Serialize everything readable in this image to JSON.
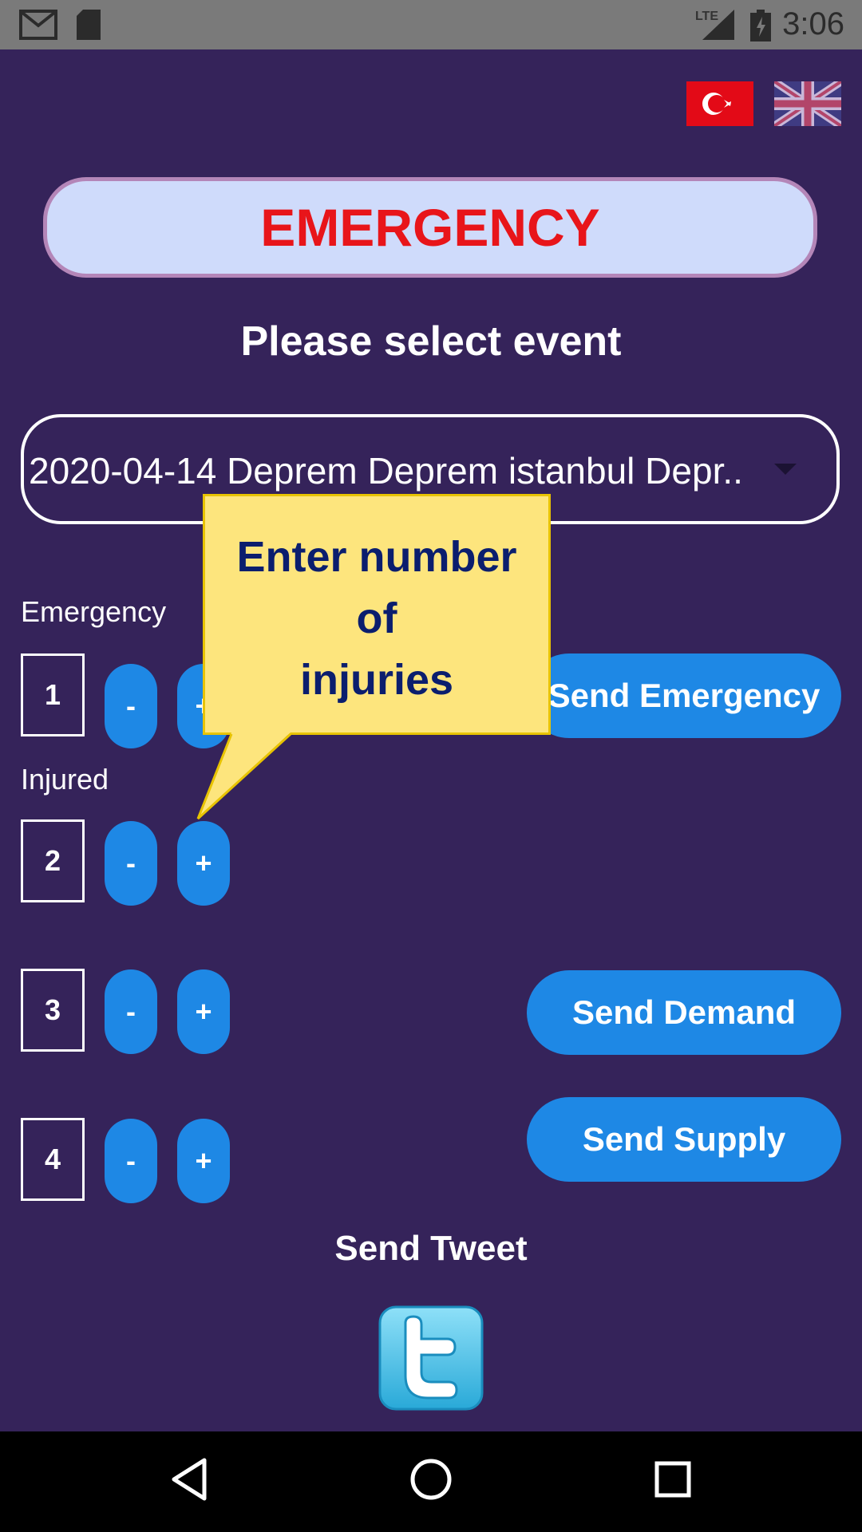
{
  "status_bar": {
    "time": "3:06",
    "network": "LTE"
  },
  "flags": {
    "turkish": "turkish-flag",
    "english": "uk-flag"
  },
  "header": {
    "title": "EMERGENCY",
    "subtitle": "Please select event"
  },
  "event_select": {
    "value": "2020-04-14 Deprem Deprem istanbul Depr.."
  },
  "tooltip": {
    "line1": "Enter number",
    "line2": "of",
    "line3": "injuries"
  },
  "counters": [
    {
      "label": "Emergency",
      "value": "1",
      "minus": "-",
      "plus": "+"
    },
    {
      "label": "Injured",
      "value": "2",
      "minus": "-",
      "plus": "+"
    },
    {
      "label": "",
      "value": "3",
      "minus": "-",
      "plus": "+"
    },
    {
      "label": "",
      "value": "4",
      "minus": "-",
      "plus": "+"
    }
  ],
  "buttons": {
    "send_emergency": "Send Emergency",
    "send_demand": "Send Demand",
    "send_supply": "Send Supply"
  },
  "tweet": {
    "label": "Send Tweet",
    "icon": "twitter-icon"
  },
  "colors": {
    "background": "#35235A",
    "accent": "#1E88E5",
    "title": "#E8151A",
    "tooltip": "#FDE57D"
  }
}
